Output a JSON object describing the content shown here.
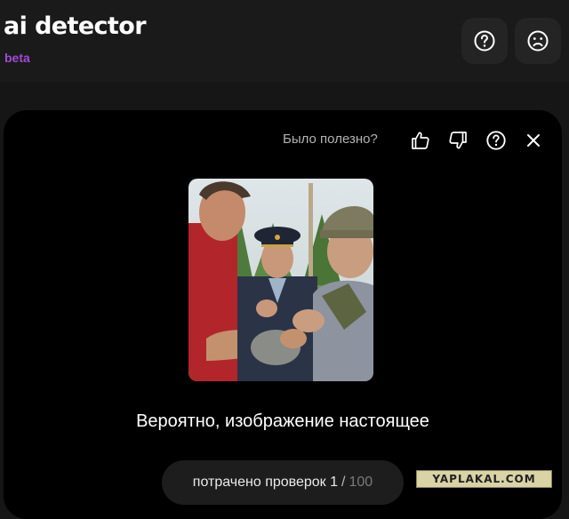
{
  "header": {
    "logo_text": "ai detector",
    "badge": "beta",
    "help_icon": "question-circle-icon",
    "account_icon": "sad-face-icon"
  },
  "feedback": {
    "prompt": "Было полезно?",
    "icons": [
      "thumbs-up-icon",
      "thumbs-down-icon",
      "question-circle-icon",
      "close-icon"
    ]
  },
  "result": {
    "verdict": "Вероятно, изображение настоящее"
  },
  "usage": {
    "label": "потрачено проверок",
    "used": "1",
    "separator": "/",
    "total": "100"
  },
  "watermark": {
    "text": "YAPLAKAL.COM"
  },
  "colors": {
    "background": "#161616",
    "card": "#000000",
    "badge": "#a04bd6"
  }
}
